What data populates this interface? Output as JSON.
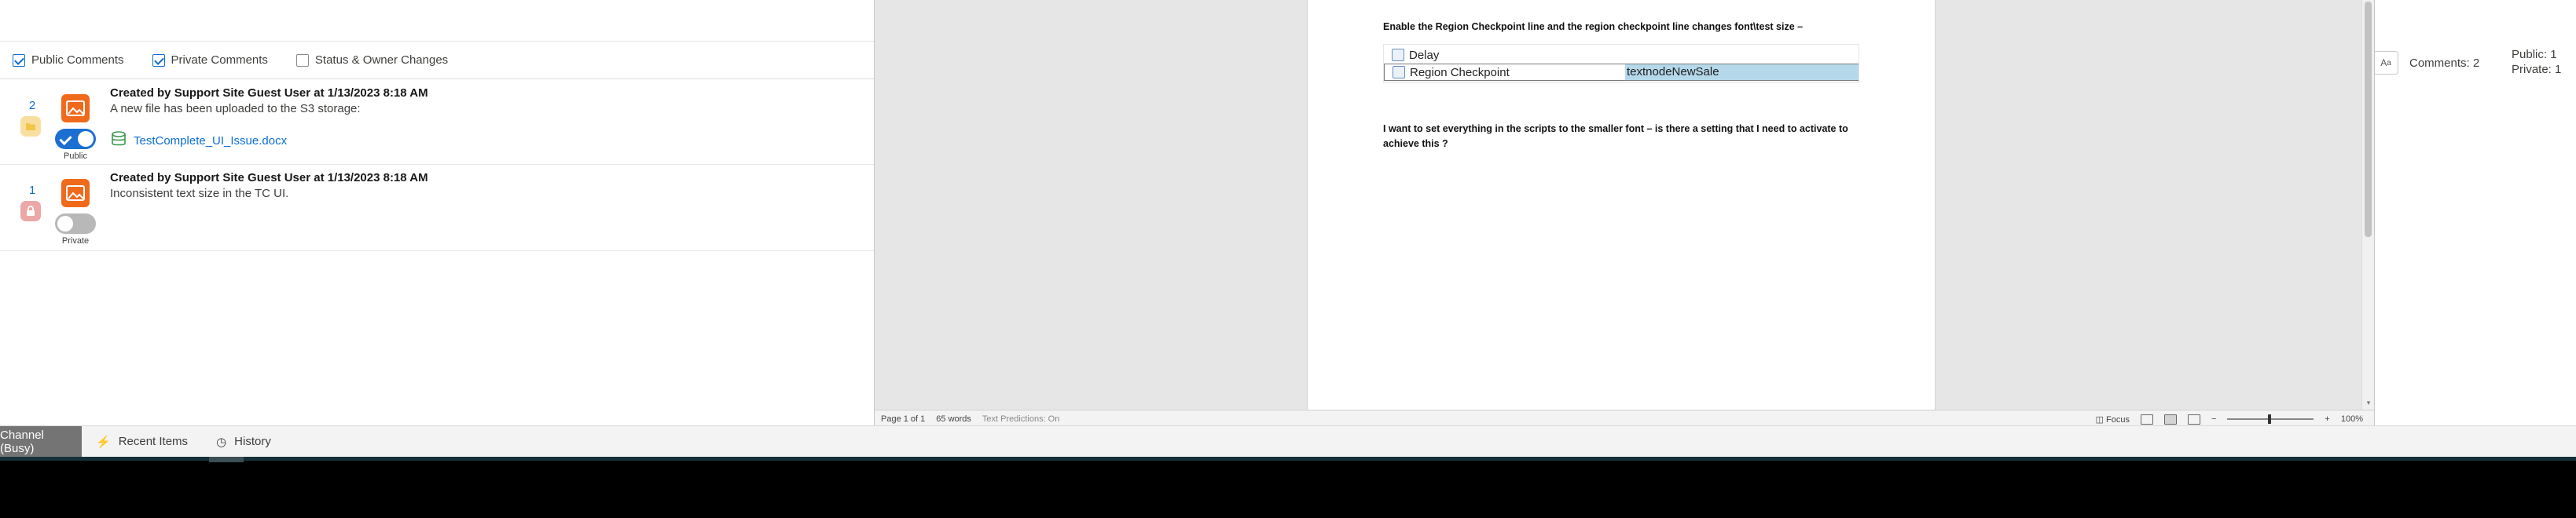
{
  "filters": [
    {
      "label": "Public Comments",
      "checked": true
    },
    {
      "label": "Private Comments",
      "checked": true
    },
    {
      "label": "Status & Owner Changes",
      "checked": false
    }
  ],
  "comments": [
    {
      "number": "2",
      "visibility_icon": "folder-icon",
      "author_line": "Created by Support Site Guest User at 1/13/2023 8:18 AM",
      "body": "A new file has been uploaded to the S3 storage:",
      "attachment": "TestComplete_UI_Issue.docx",
      "toggle_label": "Public",
      "toggle_on": true
    },
    {
      "number": "1",
      "visibility_icon": "lock-icon",
      "author_line": "Created by Support Site Guest User at 1/13/2023 8:18 AM",
      "body": "Inconsistent text size in the TC UI.",
      "toggle_label": "Private",
      "toggle_on": false
    }
  ],
  "right_panel": {
    "comments_count": "Comments: 2",
    "public_count": "Public:  1",
    "private_count": "Private:  1"
  },
  "utility_bar": {
    "items": [
      "Channel (Busy)",
      "Recent Items",
      "History"
    ]
  },
  "document": {
    "para1": "Enable the Region Checkpoint line and the region checkpoint line changes font\\test size –",
    "snippet_rows": [
      {
        "label": "Delay",
        "value": ""
      },
      {
        "label": "Region Checkpoint",
        "value": "textnodeNewSale"
      }
    ],
    "para2": "I want to set everything in the scripts to the smaller font – is there a setting that I need to activate to achieve this ?"
  },
  "word_status": {
    "page": "Page 1 of 1",
    "words": "65 words",
    "predictions": "Text Predictions: On",
    "focus": "Focus",
    "zoom": "100%"
  },
  "colors": {
    "accent": "#0b6ed5",
    "avatar": "#f06a1c",
    "toggle_on": "#1b6fd1",
    "selection": "#b5d9ea"
  }
}
